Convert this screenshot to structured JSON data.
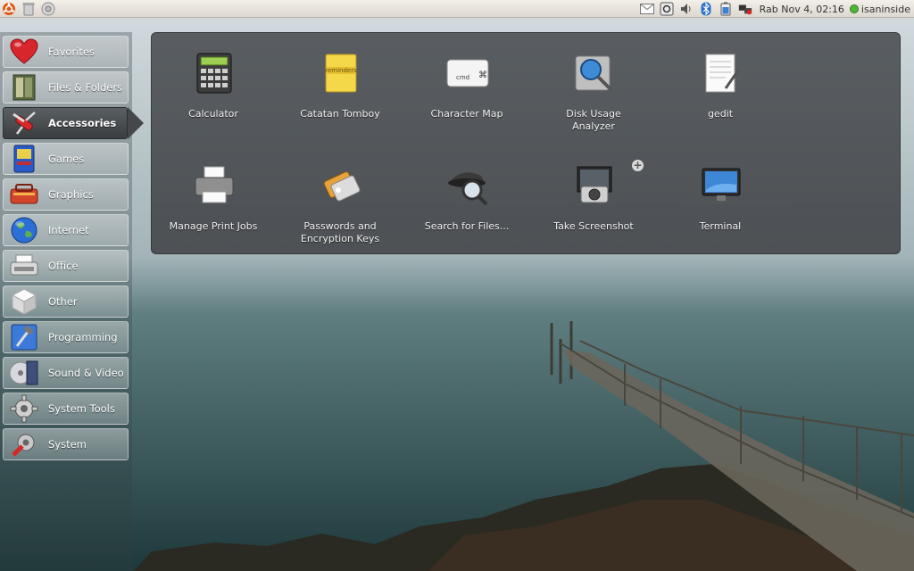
{
  "top_panel": {
    "left_icons": [
      "ubuntu-logo-icon",
      "trash-icon",
      "home-drive-icon"
    ],
    "tray_icons": [
      "mail-icon",
      "network-icon",
      "volume-icon",
      "bluetooth-icon",
      "battery-icon",
      "network-wired-icon"
    ],
    "clock": "Rab Nov  4, 02:16",
    "username": "isaninside",
    "status_color": "#4fb438"
  },
  "sidebar": {
    "items": [
      {
        "label": "Favorites",
        "icon": "heart-icon"
      },
      {
        "label": "Files & Folders",
        "icon": "folder-icon"
      },
      {
        "label": "Accessories",
        "icon": "swiss-knife-icon",
        "active": true
      },
      {
        "label": "Games",
        "icon": "arcade-icon"
      },
      {
        "label": "Graphics",
        "icon": "paint-kit-icon"
      },
      {
        "label": "Internet",
        "icon": "globe-icon"
      },
      {
        "label": "Office",
        "icon": "typewriter-icon"
      },
      {
        "label": "Other",
        "icon": "cube-icon"
      },
      {
        "label": "Programming",
        "icon": "hammer-icon"
      },
      {
        "label": "Sound & Video",
        "icon": "media-icon"
      },
      {
        "label": "System Tools",
        "icon": "gear-icon"
      },
      {
        "label": "System",
        "icon": "wrench-icon"
      }
    ]
  },
  "apps": [
    {
      "label": "Calculator",
      "icon": "calculator-icon"
    },
    {
      "label": "Catatan Tomboy",
      "icon": "notes-icon"
    },
    {
      "label": "Character Map",
      "icon": "keyboard-icon"
    },
    {
      "label": "Disk Usage\nAnalyzer",
      "icon": "disk-analyzer-icon"
    },
    {
      "label": "gedit",
      "icon": "text-editor-icon"
    },
    {
      "label": "Manage Print Jobs",
      "icon": "printer-icon"
    },
    {
      "label": "Passwords and\nEncryption Keys",
      "icon": "keys-icon"
    },
    {
      "label": "Search for Files...",
      "icon": "search-icon"
    },
    {
      "label": "Take Screenshot",
      "icon": "camera-icon"
    },
    {
      "label": "Terminal",
      "icon": "terminal-icon"
    }
  ],
  "add_badge": "+"
}
